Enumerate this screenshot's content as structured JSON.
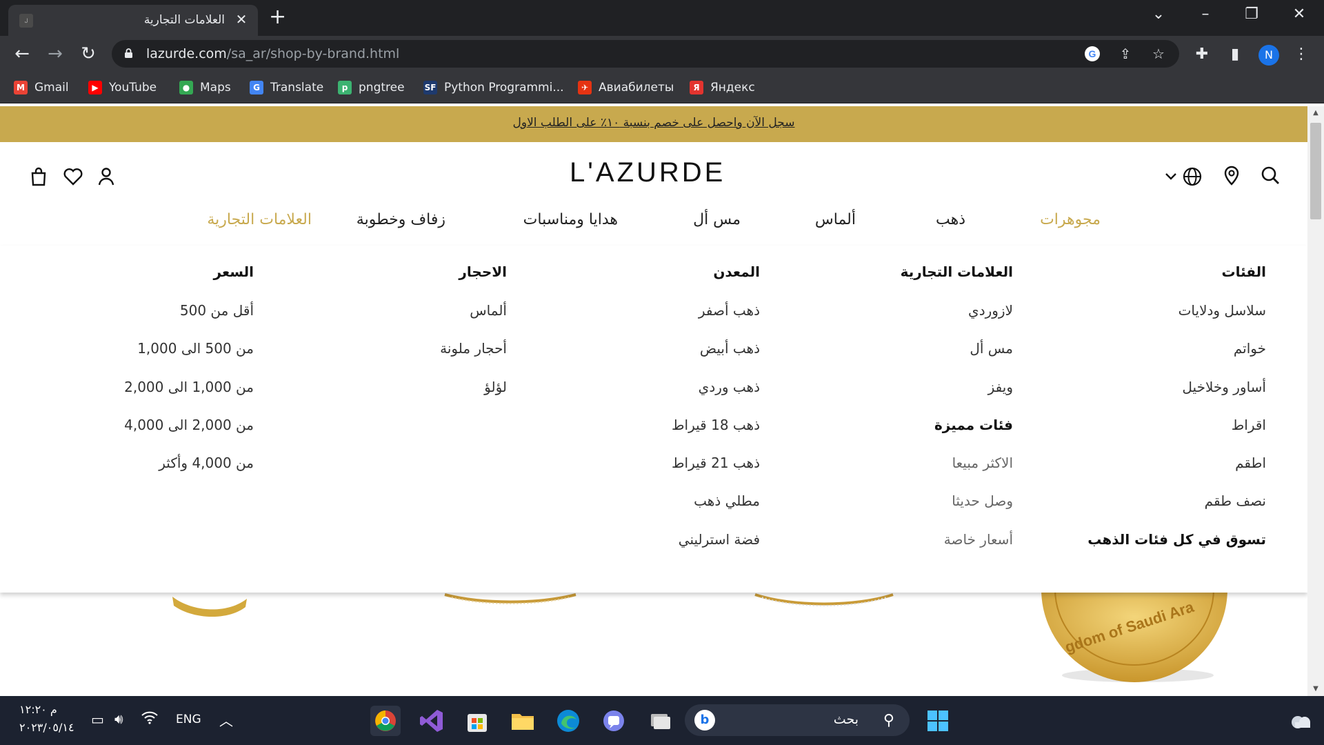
{
  "browser": {
    "tab_title": "العلامات التجارية",
    "tab_favicon_text": "ل",
    "url_domain": "lazurde.com",
    "url_path": "/sa_ar/shop-by-brand.html",
    "profile_initial": "N",
    "bookmarks": [
      {
        "label": "Gmail",
        "icon": "gmail-icon",
        "color": "#ea4335",
        "glyph": "M"
      },
      {
        "label": "YouTube",
        "icon": "youtube-icon",
        "color": "#ff0000",
        "glyph": "▶"
      },
      {
        "label": "Maps",
        "icon": "maps-icon",
        "color": "#34a853",
        "glyph": "●"
      },
      {
        "label": "Translate",
        "icon": "translate-icon",
        "color": "#4285f4",
        "glyph": "G"
      },
      {
        "label": "pngtree",
        "icon": "pngtree-icon",
        "color": "#3cb371",
        "glyph": "p"
      },
      {
        "label": "Python Programmi...",
        "icon": "python-icon",
        "color": "#1e3a6e",
        "glyph": "SF"
      },
      {
        "label": "Авиабилеты",
        "icon": "aviasales-icon",
        "color": "#e63312",
        "glyph": "✈"
      },
      {
        "label": "Яндекс",
        "icon": "yandex-icon",
        "color": "#e3342f",
        "glyph": "Я"
      }
    ]
  },
  "site": {
    "promo_text": "سجل الآن واحصل على خصم بنسبة ١٠٪ على الطلب الاول",
    "logo_text": "L'AZURDE",
    "nav": [
      {
        "label": "مجوهرات",
        "active": true
      },
      {
        "label": "ذهب",
        "active": false
      },
      {
        "label": "ألماس",
        "active": false
      },
      {
        "label": "مس أل",
        "active": false
      },
      {
        "label": "هدايا ومناسبات",
        "active": false
      },
      {
        "label": "زفاف وخطوبة",
        "active": false
      },
      {
        "label": "العلامات التجارية",
        "active": true
      }
    ],
    "mega_menu": {
      "categories": {
        "heading": "الفئات",
        "items": [
          "سلاسل ودلايات",
          "خواتم",
          "أساور وخلاخيل",
          "اقراط",
          "اطقم",
          "نصف طقم"
        ],
        "footer": "تسوق في كل فئات الذهب"
      },
      "brands": {
        "heading": "العلامات التجارية",
        "items": [
          "لازوردي",
          "مس أل",
          "ويفز"
        ],
        "sub_heading": "فئات مميزة",
        "sub_items": [
          "الاكثر مبيعا",
          "وصل حديثا",
          "أسعار خاصة"
        ]
      },
      "metal": {
        "heading": "المعدن",
        "items": [
          "ذهب أصفر",
          "ذهب أبيض",
          "ذهب وردي",
          "ذهب 18 قيراط",
          "ذهب 21 قيراط",
          "مطلي ذهب",
          "فضة استرليني"
        ]
      },
      "stones": {
        "heading": "الاحجار",
        "items": [
          "ألماس",
          "أحجار ملونة",
          "لؤلؤ"
        ]
      },
      "price": {
        "heading": "السعر",
        "items": [
          "أقل من 500",
          "من 500 الى 1,000",
          "من 1,000 الى 2,000",
          "من 2,000 الى 4,000",
          "من 4,000 وأكثر"
        ]
      }
    },
    "coin_text": "gdom of Saudi Ara"
  },
  "taskbar": {
    "time": "١٢:٢٠",
    "ampm": "م",
    "date": "٢٠٢٣/٠٥/١٤",
    "language": "ENG",
    "search_placeholder": "بحث"
  },
  "colors": {
    "gold": "#c8a94e",
    "chrome_dark": "#202124",
    "chrome_mid": "#35363a",
    "taskbar": "#1c2230"
  }
}
